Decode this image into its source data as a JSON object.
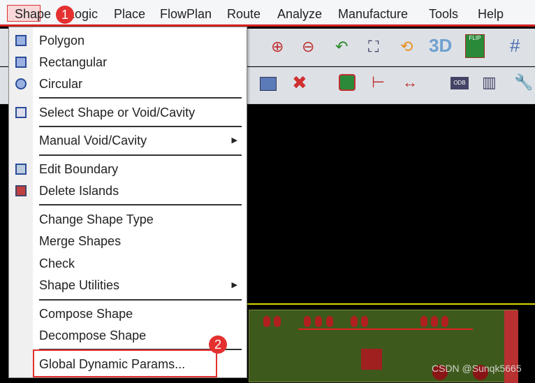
{
  "menubar": {
    "items": [
      "Shape",
      "Logic",
      "Place",
      "FlowPlan",
      "Route",
      "Analyze",
      "Manufacture",
      "Tools",
      "Help"
    ]
  },
  "badges": {
    "one": "1",
    "two": "2"
  },
  "menu": {
    "items": [
      {
        "label": "Polygon",
        "icon": "polygon-icon"
      },
      {
        "label": "Rectangular",
        "icon": "rectangle-icon"
      },
      {
        "label": "Circular",
        "icon": "circle-icon"
      },
      {
        "label": "Select Shape or Void/Cavity",
        "icon": "select-shape-icon"
      },
      {
        "label": "Manual Void/Cavity",
        "submenu": true
      },
      {
        "label": "Edit Boundary",
        "icon": "edit-boundary-icon"
      },
      {
        "label": "Delete Islands",
        "icon": "delete-islands-icon"
      },
      {
        "label": "Change Shape Type"
      },
      {
        "label": "Merge Shapes"
      },
      {
        "label": "Check"
      },
      {
        "label": "Shape Utilities",
        "submenu": true
      },
      {
        "label": "Compose Shape"
      },
      {
        "label": "Decompose Shape"
      },
      {
        "label": "Global Dynamic Params..."
      }
    ]
  },
  "toolbar": {
    "flip_label": "FLIP",
    "odb_label": "ODB",
    "three_d": "3D"
  },
  "watermark": "CSDN @Sunqk5665",
  "colors": {
    "highlight": "#e53030",
    "board": "#3d5a1c",
    "outline": "#d8d800"
  }
}
